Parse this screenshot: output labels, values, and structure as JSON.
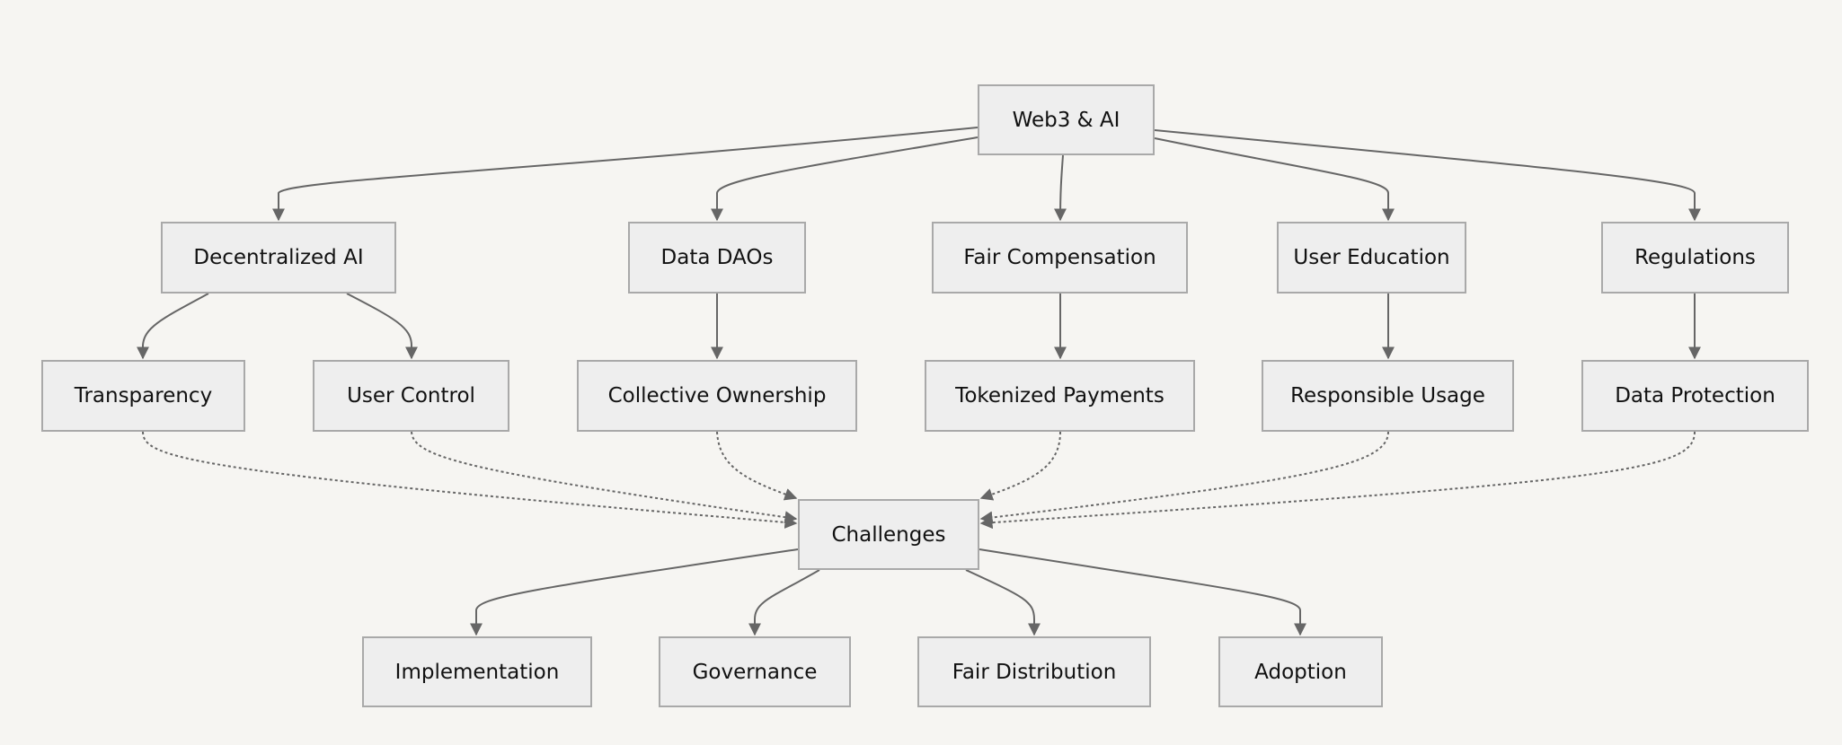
{
  "diagram": {
    "type": "flowchart",
    "colors": {
      "background": "#f6f5f2",
      "node_fill": "#eeeeee",
      "node_border": "#a9a9a9",
      "edge": "#666666",
      "text": "#111111"
    },
    "nodes": [
      {
        "id": "root",
        "label": "Web3 & AI"
      },
      {
        "id": "dai",
        "label": "Decentralized AI"
      },
      {
        "id": "dao",
        "label": "Data DAOs"
      },
      {
        "id": "fc",
        "label": "Fair Compensation"
      },
      {
        "id": "ue",
        "label": "User Education"
      },
      {
        "id": "reg",
        "label": "Regulations"
      },
      {
        "id": "tr",
        "label": "Transparency"
      },
      {
        "id": "uc",
        "label": "User Control"
      },
      {
        "id": "co",
        "label": "Collective Ownership"
      },
      {
        "id": "tp",
        "label": "Tokenized Payments"
      },
      {
        "id": "ru",
        "label": "Responsible Usage"
      },
      {
        "id": "dp",
        "label": "Data Protection"
      },
      {
        "id": "ch",
        "label": "Challenges"
      },
      {
        "id": "im",
        "label": "Implementation"
      },
      {
        "id": "gov",
        "label": "Governance"
      },
      {
        "id": "fd",
        "label": "Fair Distribution"
      },
      {
        "id": "ad",
        "label": "Adoption"
      }
    ],
    "edges": [
      {
        "from": "root",
        "to": "dai",
        "style": "solid"
      },
      {
        "from": "root",
        "to": "dao",
        "style": "solid"
      },
      {
        "from": "root",
        "to": "fc",
        "style": "solid"
      },
      {
        "from": "root",
        "to": "ue",
        "style": "solid"
      },
      {
        "from": "root",
        "to": "reg",
        "style": "solid"
      },
      {
        "from": "dai",
        "to": "tr",
        "style": "solid"
      },
      {
        "from": "dai",
        "to": "uc",
        "style": "solid"
      },
      {
        "from": "dao",
        "to": "co",
        "style": "solid"
      },
      {
        "from": "fc",
        "to": "tp",
        "style": "solid"
      },
      {
        "from": "ue",
        "to": "ru",
        "style": "solid"
      },
      {
        "from": "reg",
        "to": "dp",
        "style": "solid"
      },
      {
        "from": "tr",
        "to": "ch",
        "style": "dotted"
      },
      {
        "from": "uc",
        "to": "ch",
        "style": "dotted"
      },
      {
        "from": "co",
        "to": "ch",
        "style": "dotted"
      },
      {
        "from": "tp",
        "to": "ch",
        "style": "dotted"
      },
      {
        "from": "ru",
        "to": "ch",
        "style": "dotted"
      },
      {
        "from": "dp",
        "to": "ch",
        "style": "dotted"
      },
      {
        "from": "ch",
        "to": "im",
        "style": "solid"
      },
      {
        "from": "ch",
        "to": "gov",
        "style": "solid"
      },
      {
        "from": "ch",
        "to": "fd",
        "style": "solid"
      },
      {
        "from": "ch",
        "to": "ad",
        "style": "solid"
      }
    ]
  }
}
